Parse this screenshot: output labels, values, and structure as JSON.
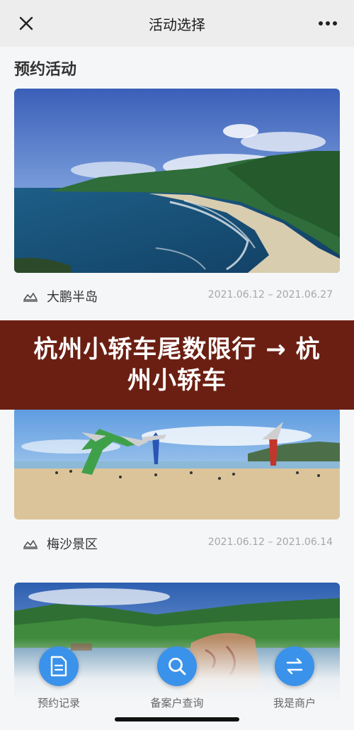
{
  "header": {
    "title": "活动选择",
    "close_icon": "close-icon",
    "more_icon": "more-dots-icon"
  },
  "section": {
    "title": "预约活动"
  },
  "activities": [
    {
      "name": "大鹏半岛",
      "dates": "2021.06.12 – 2021.06.27",
      "icon": "landscape-pin-icon"
    },
    {
      "name": "梅沙景区",
      "dates": "2021.06.12 – 2021.06.14",
      "icon": "landscape-pin-icon"
    }
  ],
  "banner": {
    "text": "杭州小轿车尾数限行 → 杭州小轿车"
  },
  "bottom_nav": [
    {
      "label": "预约记录",
      "icon": "document-icon"
    },
    {
      "label": "备案户查询",
      "icon": "search-icon"
    },
    {
      "label": "我是商户",
      "icon": "switch-arrows-icon"
    }
  ],
  "colors": {
    "accent": "#3a92ea",
    "banner": "#6b1f12",
    "topbar": "#ededed"
  }
}
